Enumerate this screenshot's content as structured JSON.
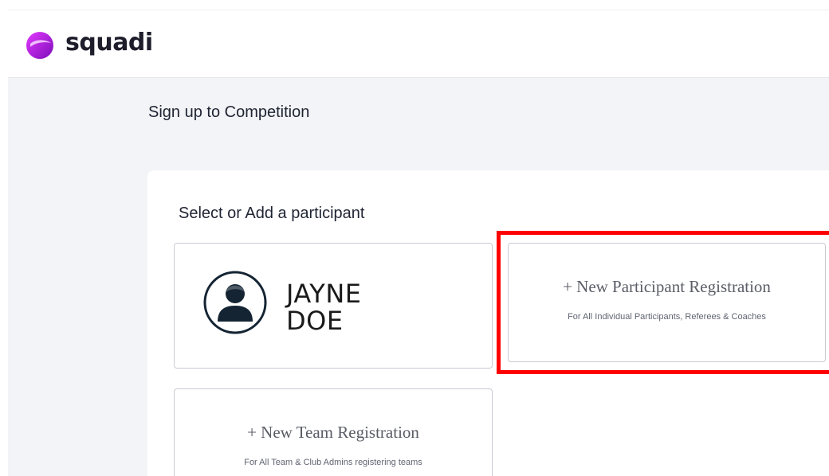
{
  "app": {
    "logo_text": "squadi",
    "brand_color": "#a31fd6"
  },
  "page": {
    "title": "Sign up to Competition"
  },
  "panel": {
    "title": "Select or Add a participant",
    "participants": [
      {
        "name_line1": "JAYNE",
        "name_line2": "DOE",
        "icon": "user-avatar-icon"
      }
    ],
    "new_participant": {
      "label": "+ New Participant Registration",
      "sub": "For All Individual Participants, Referees & Coaches"
    },
    "new_team": {
      "label": "+ New Team Registration",
      "sub": "For All Team & Club Admins registering teams"
    }
  },
  "annotation": {
    "highlight_color": "#ff0000"
  }
}
